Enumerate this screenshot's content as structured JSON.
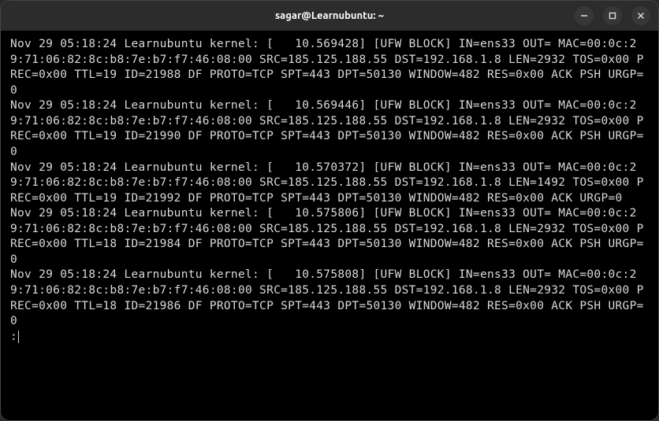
{
  "titlebar": {
    "title": "sagar@Learnubuntu: ~"
  },
  "controls": {
    "minimize": "minimize",
    "maximize": "maximize",
    "close": "close"
  },
  "terminal": {
    "lines": [
      "Nov 29 05:18:24 Learnubuntu kernel: [   10.569428] [UFW BLOCK] IN=ens33 OUT= MAC=00:0c:29:71:06:82:8c:b8:7e:b7:f7:46:08:00 SRC=185.125.188.55 DST=192.168.1.8 LEN=2932 TOS=0x00 PREC=0x00 TTL=19 ID=21988 DF PROTO=TCP SPT=443 DPT=50130 WINDOW=482 RES=0x00 ACK PSH URGP=0",
      "Nov 29 05:18:24 Learnubuntu kernel: [   10.569446] [UFW BLOCK] IN=ens33 OUT= MAC=00:0c:29:71:06:82:8c:b8:7e:b7:f7:46:08:00 SRC=185.125.188.55 DST=192.168.1.8 LEN=2932 TOS=0x00 PREC=0x00 TTL=19 ID=21990 DF PROTO=TCP SPT=443 DPT=50130 WINDOW=482 RES=0x00 ACK PSH URGP=0",
      "Nov 29 05:18:24 Learnubuntu kernel: [   10.570372] [UFW BLOCK] IN=ens33 OUT= MAC=00:0c:29:71:06:82:8c:b8:7e:b7:f7:46:08:00 SRC=185.125.188.55 DST=192.168.1.8 LEN=1492 TOS=0x00 PREC=0x00 TTL=19 ID=21992 DF PROTO=TCP SPT=443 DPT=50130 WINDOW=482 RES=0x00 ACK URGP=0",
      "Nov 29 05:18:24 Learnubuntu kernel: [   10.575806] [UFW BLOCK] IN=ens33 OUT= MAC=00:0c:29:71:06:82:8c:b8:7e:b7:f7:46:08:00 SRC=185.125.188.55 DST=192.168.1.8 LEN=2932 TOS=0x00 PREC=0x00 TTL=18 ID=21984 DF PROTO=TCP SPT=443 DPT=50130 WINDOW=482 RES=0x00 ACK PSH URGP=0",
      "Nov 29 05:18:24 Learnubuntu kernel: [   10.575808] [UFW BLOCK] IN=ens33 OUT= MAC=00:0c:29:71:06:82:8c:b8:7e:b7:f7:46:08:00 SRC=185.125.188.55 DST=192.168.1.8 LEN=2932 TOS=0x00 PREC=0x00 TTL=18 ID=21986 DF PROTO=TCP SPT=443 DPT=50130 WINDOW=482 RES=0x00 ACK PSH URGP=0"
    ],
    "prompt": ":"
  }
}
